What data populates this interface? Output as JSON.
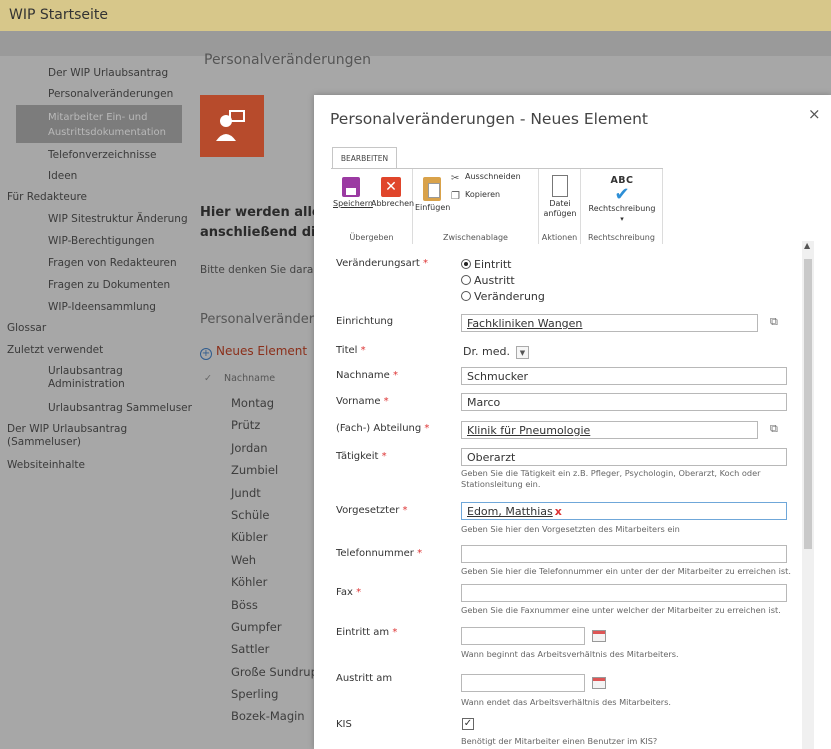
{
  "app": {
    "title": "WIP Startseite"
  },
  "nav": {
    "items": [
      {
        "label": "Der WIP Urlaubsantrag",
        "level": "sub"
      },
      {
        "label": "Personalveränderungen",
        "level": "sub"
      },
      {
        "label": "Mitarbeiter Ein- und Austrittsdokumentation",
        "level": "sub",
        "selected": true
      },
      {
        "label": "Telefonverzeichnisse",
        "level": "sub"
      },
      {
        "label": "Ideen",
        "level": "sub"
      },
      {
        "label": "Für Redakteure",
        "level": "top"
      },
      {
        "label": "WIP Sitestruktur Änderung",
        "level": "sub"
      },
      {
        "label": "WIP-Berechtigungen",
        "level": "sub"
      },
      {
        "label": "Fragen von Redakteuren",
        "level": "sub"
      },
      {
        "label": "Fragen zu Dokumenten",
        "level": "sub"
      },
      {
        "label": "WIP-Ideensammlung",
        "level": "sub"
      },
      {
        "label": "Glossar",
        "level": "top"
      },
      {
        "label": "Zuletzt verwendet",
        "level": "top"
      },
      {
        "label": "Urlaubsantrag Administration",
        "level": "sub"
      },
      {
        "label": "Urlaubsantrag Sammeluser",
        "level": "sub"
      },
      {
        "label": "Der WIP Urlaubsantrag (Sammeluser)",
        "level": "top"
      },
      {
        "label": "Websiteinhalte",
        "level": "top"
      }
    ]
  },
  "background": {
    "heading": "Personalveränderungen",
    "bold_line1": "Hier werden alle",
    "bold_line2": "anschließend die",
    "note": "Bitte denken Sie daran",
    "section": "Personalveränderu",
    "new_item": "Neues Element",
    "column_header": "Nachname",
    "rows": [
      "Montag",
      "Prütz",
      "Jordan",
      "Zumbiel",
      "Jundt",
      "Schüle",
      "Kübler",
      "Weh",
      "Köhler",
      "Böss",
      "Gumpfer",
      "Sattler",
      "Große Sundrup",
      "Sperling",
      "Bozek-Magin"
    ]
  },
  "dialog": {
    "title": "Personalveränderungen - Neues Element",
    "close": "×",
    "ribbon": {
      "tab": "BEARBEITEN",
      "save": "Speichern",
      "cancel": "Abbrechen",
      "paste": "Einfügen",
      "cut": "Ausschneiden",
      "copy": "Kopieren",
      "attach_line1": "Datei",
      "attach_line2": "anfügen",
      "spelling": "Rechtschreibung",
      "spelling_icon_text": "ABC",
      "groups": {
        "commit": "Übergeben",
        "clipboard": "Zwischenablage",
        "actions": "Aktionen",
        "spelling": "Rechtschreibung"
      }
    },
    "form": {
      "change_type": {
        "label": "Veränderungsart",
        "options": [
          "Eintritt",
          "Austritt",
          "Veränderung"
        ],
        "selected": "Eintritt"
      },
      "institution": {
        "label": "Einrichtung",
        "value": "Fachkliniken Wangen"
      },
      "title": {
        "label": "Titel",
        "value": "Dr. med."
      },
      "last_name": {
        "label": "Nachname",
        "value": "Schmucker"
      },
      "first_name": {
        "label": "Vorname",
        "value": "Marco"
      },
      "department": {
        "label": "(Fach-) Abteilung",
        "value": "Klinik für Pneumologie"
      },
      "job": {
        "label": "Tätigkeit",
        "value": "Oberarzt",
        "hint": "Geben Sie die Tätigkeit ein z.B. Pfleger, Psychologin, Oberarzt, Koch oder Stationsleitung ein."
      },
      "supervisor": {
        "label": "Vorgesetzter",
        "value": "Edom, Matthias",
        "remove": "x",
        "hint": "Geben Sie hier den Vorgesetzten des Mitarbeiters ein"
      },
      "phone": {
        "label": "Telefonnummer",
        "value": "",
        "hint": "Geben Sie hier die Telefonnummer ein unter der der Mitarbeiter zu erreichen ist."
      },
      "fax": {
        "label": "Fax",
        "value": "",
        "hint": "Geben Sie die Faxnummer eine unter welcher der Mitarbeiter zu erreichen ist."
      },
      "start_date": {
        "label": "Eintritt am",
        "value": "",
        "hint": "Wann beginnt das Arbeitsverhältnis des Mitarbeiters."
      },
      "end_date": {
        "label": "Austritt am",
        "value": "",
        "hint": "Wann endet das Arbeitsverhältnis des Mitarbeiters."
      },
      "kis": {
        "label": "KIS",
        "checked": true,
        "hint": "Benötigt der Mitarbeiter einen Benutzer im KIS?"
      },
      "required_marker": "*"
    }
  },
  "colors": {
    "topbar": "#d7c78a",
    "tile": "#b74b2c",
    "required": "#dd3333",
    "accent": "#2e8fd6"
  }
}
